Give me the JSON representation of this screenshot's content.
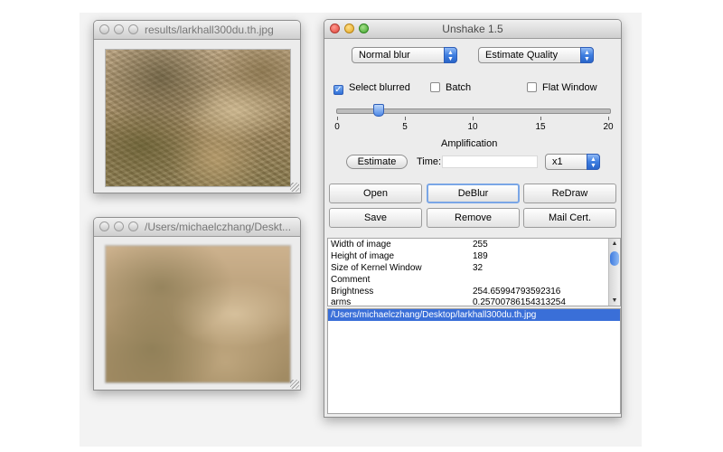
{
  "window1": {
    "title": "results/larkhall300du.th.jpg"
  },
  "window2": {
    "title": "/Users/michaelczhang/Deskt..."
  },
  "main": {
    "title": "Unshake 1.5",
    "blur_select": "Normal blur",
    "quality_select": "Estimate Quality",
    "checkboxes": [
      {
        "label": "Select blurred",
        "checked": true
      },
      {
        "label": "Batch",
        "checked": false
      },
      {
        "label": "Flat Window",
        "checked": false
      }
    ],
    "slider": {
      "value": 3,
      "min": 0,
      "max": 20,
      "ticks": [
        "0",
        "5",
        "10",
        "15",
        "20"
      ],
      "label": "Amplification"
    },
    "estimate_label": "Estimate",
    "time_label": "Time:",
    "time_value": "",
    "multiplier": "x1",
    "buttons": {
      "open": "Open",
      "deblur": "DeBlur",
      "redraw": "ReDraw",
      "save": "Save",
      "remove": "Remove",
      "mail": "Mail Cert."
    },
    "info_rows": [
      {
        "label": "Width of image",
        "value": "255"
      },
      {
        "label": "Height of image",
        "value": "189"
      },
      {
        "label": "Size of Kernel Window",
        "value": "32"
      },
      {
        "label": "Comment",
        "value": ""
      },
      {
        "label": "Brightness",
        "value": "254.65994793592316"
      },
      {
        "label": "arms",
        "value": "0.25700786154313254"
      }
    ],
    "files": [
      "/Users/michaelczhang/Desktop/larkhall300du.th.jpg"
    ]
  },
  "icons": {
    "checkmark": "check-icon",
    "popup_arrows": "up-down-arrows-icon",
    "scroll_up": "scroll-up-arrow-icon",
    "scroll_down": "scroll-down-arrow-icon"
  },
  "colors": {
    "selection": "#3a6fd8",
    "accent": "#2d5db8"
  }
}
